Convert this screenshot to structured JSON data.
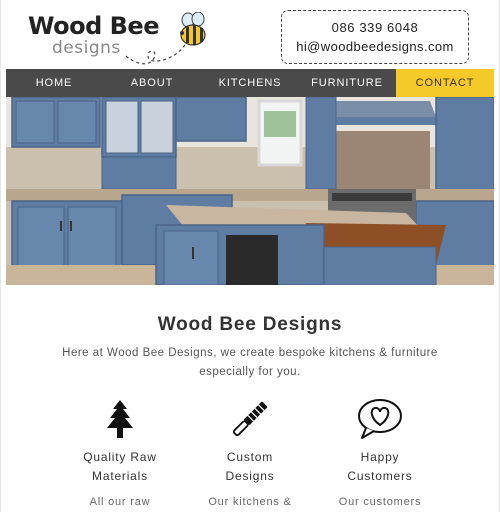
{
  "brand": {
    "name": "Wood Bee",
    "sub": "designs"
  },
  "contact": {
    "phone": "086 339 6048",
    "email": "hi@woodbeedesigns.com"
  },
  "nav": {
    "items": [
      {
        "label": "HOME"
      },
      {
        "label": "ABOUT"
      },
      {
        "label": "KITCHENS"
      },
      {
        "label": "FURNITURE"
      },
      {
        "label": "CONTACT",
        "active": true
      }
    ]
  },
  "intro": {
    "title": "Wood Bee Designs",
    "text": "Here at Wood Bee Designs, we create bespoke kitchens & furniture especially for you."
  },
  "features": [
    {
      "icon": "tree-icon",
      "title_line1": "Quality Raw",
      "title_line2": "Materials",
      "text": "All our raw"
    },
    {
      "icon": "rasp-file-icon",
      "title_line1": "Custom",
      "title_line2": "Designs",
      "text": "Our kitchens &"
    },
    {
      "icon": "heart-speech-bubble-icon",
      "title_line1": "Happy",
      "title_line2": "Customers",
      "text": "Our customers"
    }
  ],
  "colors": {
    "nav_bg": "#4a4a4a",
    "accent": "#f6c92a",
    "cabinet_blue": "#5f7da3"
  }
}
